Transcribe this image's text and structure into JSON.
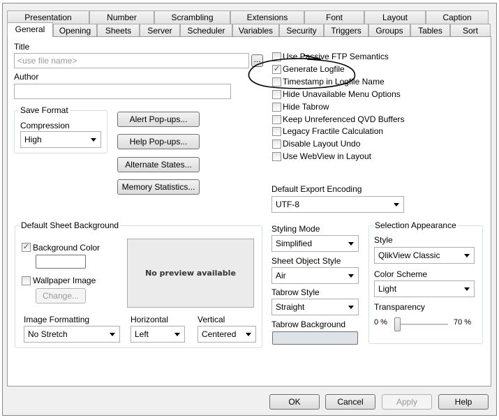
{
  "tabs_row1": [
    "Presentation",
    "Number",
    "Scrambling",
    "Extensions",
    "Font",
    "Layout",
    "Caption"
  ],
  "tabs_row2": [
    "General",
    "Opening",
    "Sheets",
    "Server",
    "Scheduler",
    "Variables",
    "Security",
    "Triggers",
    "Groups",
    "Tables",
    "Sort"
  ],
  "active_tab": "General",
  "title": {
    "label": "Title",
    "placeholder": "<use file name>",
    "browse": "..."
  },
  "author": {
    "label": "Author",
    "value": ""
  },
  "save_format": {
    "group": "Save Format",
    "compression_label": "Compression",
    "compression": "High"
  },
  "buttons": {
    "alert": "Alert Pop-ups...",
    "help": "Help Pop-ups...",
    "alternate": "Alternate States...",
    "memory": "Memory Statistics..."
  },
  "checkboxes": [
    {
      "label": "Use Passive FTP Semantics",
      "checked": false
    },
    {
      "label": "Generate Logfile",
      "checked": true
    },
    {
      "label": "Timestamp in Logfile Name",
      "checked": false
    },
    {
      "label": "Hide Unavailable Menu Options",
      "checked": false
    },
    {
      "label": "Hide Tabrow",
      "checked": false
    },
    {
      "label": "Keep Unreferenced QVD Buffers",
      "checked": false
    },
    {
      "label": "Legacy Fractile Calculation",
      "checked": false
    },
    {
      "label": "Disable Layout Undo",
      "checked": false
    },
    {
      "label": "Use WebView in Layout",
      "checked": false
    }
  ],
  "export_encoding": {
    "label": "Default Export Encoding",
    "value": "UTF-8"
  },
  "sheet_background": {
    "group": "Default Sheet Background",
    "bg_color_label": "Background Color",
    "bg_color_checked": true,
    "wallpaper_label": "Wallpaper Image",
    "wallpaper_checked": false,
    "change": "Change...",
    "preview": "No preview available",
    "image_formatting_label": "Image Formatting",
    "image_formatting": "No Stretch",
    "horizontal_label": "Horizontal",
    "horizontal": "Left",
    "vertical_label": "Vertical",
    "vertical": "Centered"
  },
  "styling": {
    "mode_label": "Styling Mode",
    "mode": "Simplified",
    "object_style_label": "Sheet Object Style",
    "object_style": "Air",
    "tabrow_style_label": "Tabrow Style",
    "tabrow_style": "Straight",
    "tabrow_bg_label": "Tabrow Background",
    "tabrow_bg_color": "#dde3e6"
  },
  "selection": {
    "group": "Selection Appearance",
    "style_label": "Style",
    "style": "QlikView Classic",
    "scheme_label": "Color Scheme",
    "scheme": "Light",
    "transparency_label": "Transparency",
    "min": "0 %",
    "max": "70 %",
    "transparency_value": 0
  },
  "footer": {
    "ok": "OK",
    "cancel": "Cancel",
    "apply": "Apply",
    "help": "Help"
  }
}
